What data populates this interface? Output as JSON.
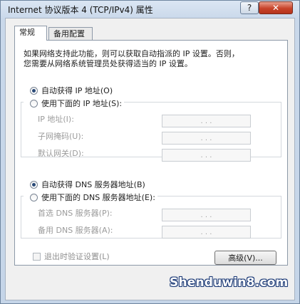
{
  "window": {
    "title": "Internet 协议版本 4 (TCP/IPv4) 属性",
    "help_label": "?",
    "close_label": "✕"
  },
  "tabs": [
    {
      "label": "常规",
      "active": true
    },
    {
      "label": "备用配置",
      "active": false
    }
  ],
  "intro": {
    "line1": "如果网络支持此功能，则可以获取自动指派的 IP 设置。否则，",
    "line2": "您需要从网络系统管理员处获得适当的 IP 设置。"
  },
  "ip_section": {
    "auto_label": "自动获得 IP 地址(O)",
    "auto_checked": true,
    "manual_label": "使用下面的 IP 地址(S):",
    "manual_checked": false,
    "fields": [
      {
        "label": "IP 地址(I):",
        "value": ". . ."
      },
      {
        "label": "子网掩码(U):",
        "value": ". . ."
      },
      {
        "label": "默认网关(D):",
        "value": ". . ."
      }
    ]
  },
  "dns_section": {
    "auto_label": "自动获得 DNS 服务器地址(B)",
    "auto_checked": true,
    "manual_label": "使用下面的 DNS 服务器地址(E):",
    "manual_checked": false,
    "fields": [
      {
        "label": "首选 DNS 服务器(P):",
        "value": ". . ."
      },
      {
        "label": "备用 DNS 服务器(A):",
        "value": ". . ."
      }
    ]
  },
  "validate_on_exit": {
    "label": "退出时验证设置(L)",
    "checked": false
  },
  "advanced_button": "高级(V)...",
  "watermark": "Shenduwin8.com"
}
